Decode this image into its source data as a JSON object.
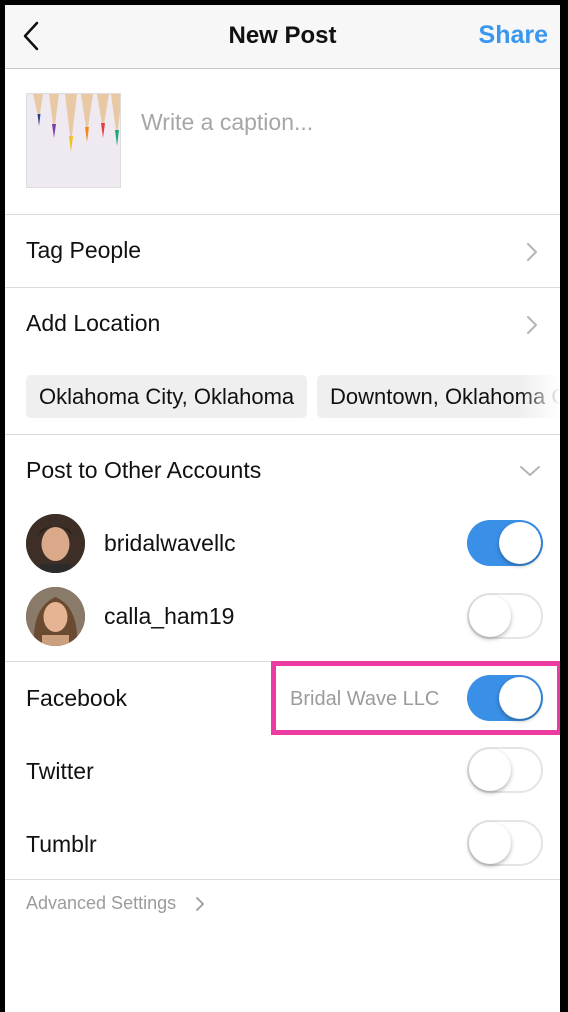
{
  "header": {
    "title": "New Post",
    "share_label": "Share",
    "back_icon": "chevron-left-icon"
  },
  "caption": {
    "placeholder": "Write a caption..."
  },
  "options": {
    "tag_people": "Tag People",
    "add_location": "Add Location"
  },
  "location_suggestions": [
    "Oklahoma City, Oklahoma",
    "Downtown, Oklahoma C"
  ],
  "other_accounts": {
    "title": "Post to Other Accounts",
    "accounts": [
      {
        "username": "bridalwavellc",
        "enabled": true
      },
      {
        "username": "calla_ham19",
        "enabled": false
      }
    ]
  },
  "share_to": {
    "facebook": {
      "label": "Facebook",
      "account": "Bridal Wave LLC",
      "enabled": true
    },
    "twitter": {
      "label": "Twitter",
      "enabled": false
    },
    "tumblr": {
      "label": "Tumblr",
      "enabled": false
    }
  },
  "advanced_settings": "Advanced Settings",
  "colors": {
    "accent": "#3897f0",
    "toggle_on": "#3a8fe6",
    "highlight": "#ec3ba1"
  }
}
